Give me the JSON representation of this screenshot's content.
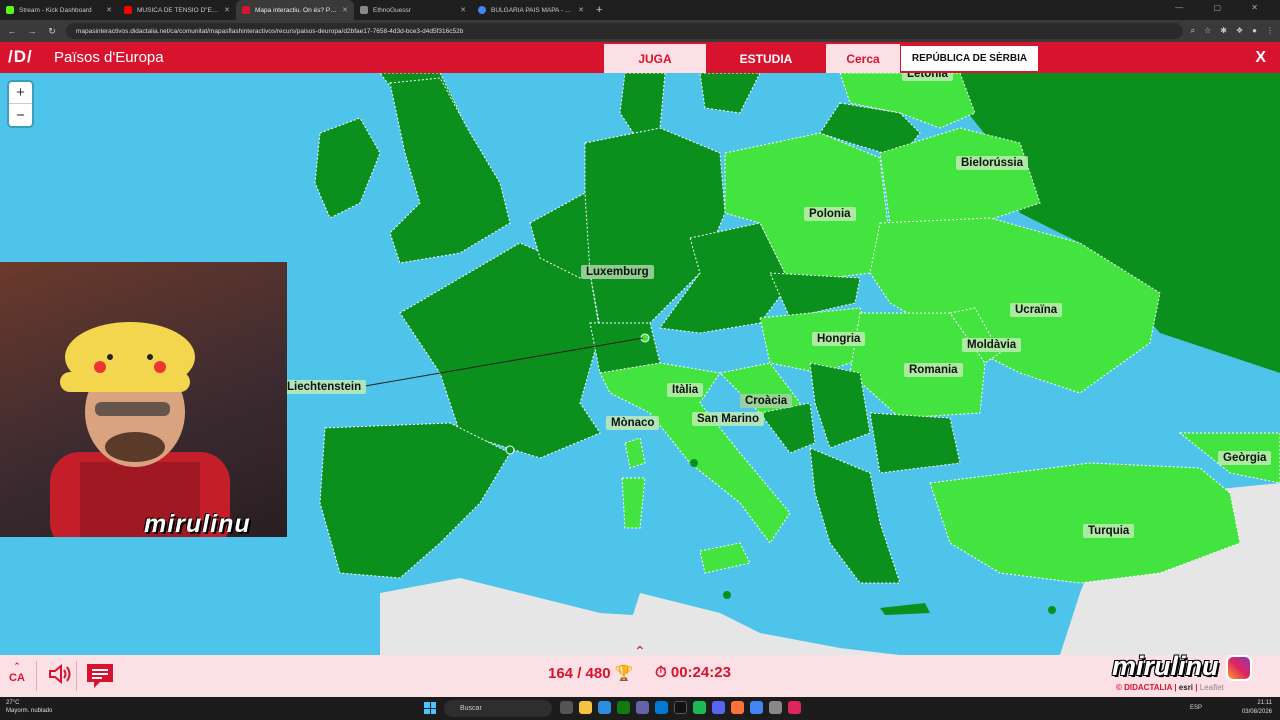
{
  "browser": {
    "tabs": [
      {
        "label": "Stream - Kick Dashboard",
        "color": "#53fc18",
        "active": false
      },
      {
        "label": "MÚSICA DE TENSIÓ D\"EL...",
        "color": "#ff0000",
        "active": false
      },
      {
        "label": "Mapa interactiu. On és? Països...",
        "color": "#d8132e",
        "active": true
      },
      {
        "label": "EthnoGuessr",
        "color": "#888888",
        "active": false
      },
      {
        "label": "BULGARIA PAIS MAPA - Cerca...",
        "color": "#4285f4",
        "active": false
      }
    ],
    "url": "mapasinteractivos.didactalia.net/ca/comunitat/mapasflashinteractivos/recurs/paisos-deuropa/d2bfae17-7658-4d3d-bce3-d4d5f316c52b"
  },
  "app": {
    "logo": "/D/",
    "title": "Països d'Europa",
    "buttons": {
      "play": "JUGA",
      "study": "ESTUDIA",
      "search": "Cerca"
    },
    "current_question": "REPÚBLICA DE SÈRBIA",
    "close": "X",
    "accent_color": "#d8132e"
  },
  "map": {
    "zoom_in": "+",
    "zoom_out": "−",
    "colors": {
      "sea": "#4fc4ea",
      "found": "#0b8f1d",
      "pending": "#43e43f",
      "outside": "#e6e6e6"
    },
    "labels": {
      "letonia": "Letònia",
      "bielorussia": "Bielorússia",
      "polonia": "Polonia",
      "luxemburg": "Luxemburg",
      "ucraina": "Ucraïna",
      "hongria": "Hongria",
      "moldavia": "Moldàvia",
      "romania": "Romania",
      "liechtenstein": "Liechtenstein",
      "italia": "Itàlia",
      "croacia": "Croàcia",
      "monaco": "Mònaco",
      "san_marino": "San Marino",
      "georgia": "Geòrgia",
      "turquia": "Turquia"
    }
  },
  "stream": {
    "overlay_name": "mirulinu"
  },
  "footer": {
    "lang": "CA",
    "score": "164 / 480",
    "timer": "00:24:23",
    "brand": "mirulinu",
    "credits": {
      "didactalia": "© DIDACTALIA",
      "esri": "esri",
      "leaflet": "Leaflet"
    }
  },
  "taskbar": {
    "weather_temp": "27°C",
    "weather_desc": "Mayorm. nublado",
    "search": "Buscar",
    "lang": "ESP",
    "time": "21:11",
    "date": "03/08/2026"
  }
}
